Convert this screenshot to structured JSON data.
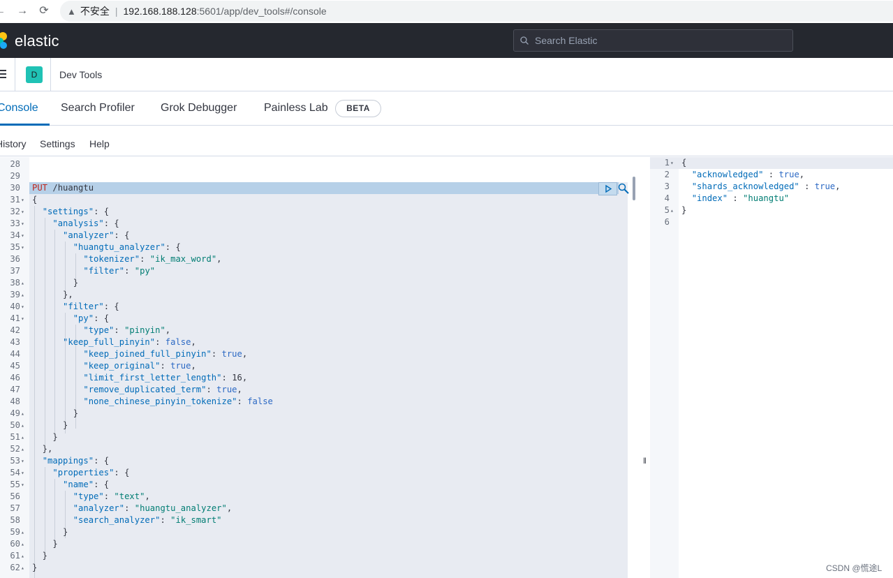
{
  "browser": {
    "back_icon": "arrow-left-icon",
    "forward_icon": "arrow-right-icon",
    "reload_icon": "reload-icon",
    "security_label": "不安全",
    "url_host": "192.168.188.128",
    "url_rest": ":5601/app/dev_tools#/console"
  },
  "kibana": {
    "brand": "elastic",
    "search_placeholder": "Search Elastic",
    "space_initial": "D",
    "breadcrumb": "Dev Tools"
  },
  "tabs": [
    {
      "label": "Console",
      "active": true
    },
    {
      "label": "Search Profiler",
      "active": false
    },
    {
      "label": "Grok Debugger",
      "active": false
    },
    {
      "label": "Painless Lab",
      "active": false
    }
  ],
  "beta_badge": "BETA",
  "console_menu": [
    "History",
    "Settings",
    "Help"
  ],
  "colors": {
    "accent": "#006bb8",
    "header_bg": "#25282f",
    "space_avatar": "#20c2b5"
  },
  "editor": {
    "lines": [
      {
        "n": "28",
        "fold": "",
        "segs": []
      },
      {
        "n": "29",
        "fold": "",
        "segs": []
      },
      {
        "n": "30",
        "fold": "",
        "segs": [
          [
            "method",
            "PUT"
          ],
          [
            "k",
            " /huangtu"
          ]
        ]
      },
      {
        "n": "31",
        "fold": "▾",
        "segs": [
          [
            "k",
            "{"
          ]
        ]
      },
      {
        "n": "32",
        "fold": "▾",
        "segs": [
          [
            "k",
            "  "
          ],
          [
            "key",
            "\"settings\""
          ],
          [
            "k",
            ": {"
          ]
        ]
      },
      {
        "n": "33",
        "fold": "▾",
        "segs": [
          [
            "k",
            "    "
          ],
          [
            "key",
            "\"analysis\""
          ],
          [
            "k",
            ": {"
          ]
        ]
      },
      {
        "n": "34",
        "fold": "▾",
        "segs": [
          [
            "k",
            "      "
          ],
          [
            "key",
            "\"analyzer\""
          ],
          [
            "k",
            ": {"
          ]
        ]
      },
      {
        "n": "35",
        "fold": "▾",
        "segs": [
          [
            "k",
            "        "
          ],
          [
            "key",
            "\"huangtu_analyzer\""
          ],
          [
            "k",
            ": {"
          ]
        ]
      },
      {
        "n": "36",
        "fold": "",
        "segs": [
          [
            "k",
            "          "
          ],
          [
            "key",
            "\"tokenizer\""
          ],
          [
            "k",
            ": "
          ],
          [
            "str",
            "\"ik_max_word\""
          ],
          [
            "k",
            ","
          ]
        ]
      },
      {
        "n": "37",
        "fold": "",
        "segs": [
          [
            "k",
            "          "
          ],
          [
            "key",
            "\"filter\""
          ],
          [
            "k",
            ": "
          ],
          [
            "str",
            "\"py\""
          ]
        ]
      },
      {
        "n": "38",
        "fold": "▴",
        "segs": [
          [
            "k",
            "        }"
          ]
        ]
      },
      {
        "n": "39",
        "fold": "▴",
        "segs": [
          [
            "k",
            "      },"
          ]
        ]
      },
      {
        "n": "40",
        "fold": "▾",
        "segs": [
          [
            "k",
            "      "
          ],
          [
            "key",
            "\"filter\""
          ],
          [
            "k",
            ": {"
          ]
        ]
      },
      {
        "n": "41",
        "fold": "▾",
        "segs": [
          [
            "k",
            "        "
          ],
          [
            "key",
            "\"py\""
          ],
          [
            "k",
            ": {"
          ]
        ]
      },
      {
        "n": "42",
        "fold": "",
        "segs": [
          [
            "k",
            "          "
          ],
          [
            "key",
            "\"type\""
          ],
          [
            "k",
            ": "
          ],
          [
            "str",
            "\"pinyin\""
          ],
          [
            "k",
            ","
          ]
        ]
      },
      {
        "n": "43",
        "fold": "",
        "segs": [
          [
            "k",
            "      "
          ],
          [
            "key",
            "\"keep_full_pinyin\""
          ],
          [
            "k",
            ": "
          ],
          [
            "bool",
            "false"
          ],
          [
            "k",
            ","
          ]
        ]
      },
      {
        "n": "44",
        "fold": "",
        "segs": [
          [
            "k",
            "          "
          ],
          [
            "key",
            "\"keep_joined_full_pinyin\""
          ],
          [
            "k",
            ": "
          ],
          [
            "bool",
            "true"
          ],
          [
            "k",
            ","
          ]
        ]
      },
      {
        "n": "45",
        "fold": "",
        "segs": [
          [
            "k",
            "          "
          ],
          [
            "key",
            "\"keep_original\""
          ],
          [
            "k",
            ": "
          ],
          [
            "bool",
            "true"
          ],
          [
            "k",
            ","
          ]
        ]
      },
      {
        "n": "46",
        "fold": "",
        "segs": [
          [
            "k",
            "          "
          ],
          [
            "key",
            "\"limit_first_letter_length\""
          ],
          [
            "k",
            ": "
          ],
          [
            "num",
            "16"
          ],
          [
            "k",
            ","
          ]
        ]
      },
      {
        "n": "47",
        "fold": "",
        "segs": [
          [
            "k",
            "          "
          ],
          [
            "key",
            "\"remove_duplicated_term\""
          ],
          [
            "k",
            ": "
          ],
          [
            "bool",
            "true"
          ],
          [
            "k",
            ","
          ]
        ]
      },
      {
        "n": "48",
        "fold": "",
        "segs": [
          [
            "k",
            "          "
          ],
          [
            "key",
            "\"none_chinese_pinyin_tokenize\""
          ],
          [
            "k",
            ": "
          ],
          [
            "bool",
            "false"
          ]
        ]
      },
      {
        "n": "49",
        "fold": "▴",
        "segs": [
          [
            "k",
            "        }"
          ]
        ]
      },
      {
        "n": "50",
        "fold": "▴",
        "segs": [
          [
            "k",
            "      }"
          ]
        ]
      },
      {
        "n": "51",
        "fold": "▴",
        "segs": [
          [
            "k",
            "    }"
          ]
        ]
      },
      {
        "n": "52",
        "fold": "▴",
        "segs": [
          [
            "k",
            "  },"
          ]
        ]
      },
      {
        "n": "53",
        "fold": "▾",
        "segs": [
          [
            "k",
            "  "
          ],
          [
            "key",
            "\"mappings\""
          ],
          [
            "k",
            ": {"
          ]
        ]
      },
      {
        "n": "54",
        "fold": "▾",
        "segs": [
          [
            "k",
            "    "
          ],
          [
            "key",
            "\"properties\""
          ],
          [
            "k",
            ": {"
          ]
        ]
      },
      {
        "n": "55",
        "fold": "▾",
        "segs": [
          [
            "k",
            "      "
          ],
          [
            "key",
            "\"name\""
          ],
          [
            "k",
            ": {"
          ]
        ]
      },
      {
        "n": "56",
        "fold": "",
        "segs": [
          [
            "k",
            "        "
          ],
          [
            "key",
            "\"type\""
          ],
          [
            "k",
            ": "
          ],
          [
            "str",
            "\"text\""
          ],
          [
            "k",
            ","
          ]
        ]
      },
      {
        "n": "57",
        "fold": "",
        "segs": [
          [
            "k",
            "        "
          ],
          [
            "key",
            "\"analyzer\""
          ],
          [
            "k",
            ": "
          ],
          [
            "str",
            "\"huangtu_analyzer\""
          ],
          [
            "k",
            ","
          ]
        ]
      },
      {
        "n": "58",
        "fold": "",
        "segs": [
          [
            "k",
            "        "
          ],
          [
            "key",
            "\"search_analyzer\""
          ],
          [
            "k",
            ": "
          ],
          [
            "str",
            "\"ik_smart\""
          ]
        ]
      },
      {
        "n": "59",
        "fold": "▴",
        "segs": [
          [
            "k",
            "      }"
          ]
        ]
      },
      {
        "n": "60",
        "fold": "▴",
        "segs": [
          [
            "k",
            "    }"
          ]
        ]
      },
      {
        "n": "61",
        "fold": "▴",
        "segs": [
          [
            "k",
            "  }"
          ]
        ]
      },
      {
        "n": "62",
        "fold": "▴",
        "segs": [
          [
            "k",
            "}"
          ]
        ]
      }
    ]
  },
  "output": {
    "lines": [
      {
        "n": "1",
        "fold": "▾",
        "segs": [
          [
            "k",
            "{"
          ]
        ]
      },
      {
        "n": "2",
        "fold": "",
        "segs": [
          [
            "k",
            "  "
          ],
          [
            "key",
            "\"acknowledged\""
          ],
          [
            "k",
            " : "
          ],
          [
            "bool",
            "true"
          ],
          [
            "k",
            ","
          ]
        ]
      },
      {
        "n": "3",
        "fold": "",
        "segs": [
          [
            "k",
            "  "
          ],
          [
            "key",
            "\"shards_acknowledged\""
          ],
          [
            "k",
            " : "
          ],
          [
            "bool",
            "true"
          ],
          [
            "k",
            ","
          ]
        ]
      },
      {
        "n": "4",
        "fold": "",
        "segs": [
          [
            "k",
            "  "
          ],
          [
            "key",
            "\"index\""
          ],
          [
            "k",
            " : "
          ],
          [
            "str",
            "\"huangtu\""
          ]
        ]
      },
      {
        "n": "5",
        "fold": "▴",
        "segs": [
          [
            "k",
            "}"
          ]
        ]
      },
      {
        "n": "6",
        "fold": "",
        "segs": []
      }
    ]
  },
  "watermark": "CSDN @慌途L"
}
